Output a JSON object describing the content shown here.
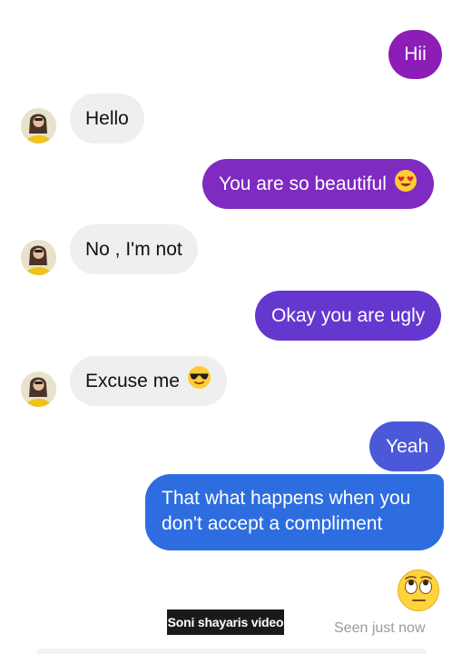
{
  "messages": {
    "m1": "Hii",
    "m2": "Hello",
    "m3": "You are so beautiful",
    "m4": "No , I'm not",
    "m5": "Okay you are ugly",
    "m6": "Excuse me",
    "m7": "Yeah",
    "m8": "That what happens when you don't accept a compliment"
  },
  "caption": "Soni shayaris video",
  "status": "Seen just now",
  "icons": {
    "heart_eyes": "heart-eyes-emoji-icon",
    "sunglasses": "sunglasses-emoji-icon",
    "rolling_eyes": "rolling-eyes-emoji-icon",
    "avatar": "contact-avatar"
  },
  "colors": {
    "outgoing_top": "#8a1fb8",
    "outgoing_mid": "#6638cf",
    "outgoing_bottom": "#2d6de0",
    "incoming": "#efefef",
    "seen_text": "#9b9b9b"
  }
}
